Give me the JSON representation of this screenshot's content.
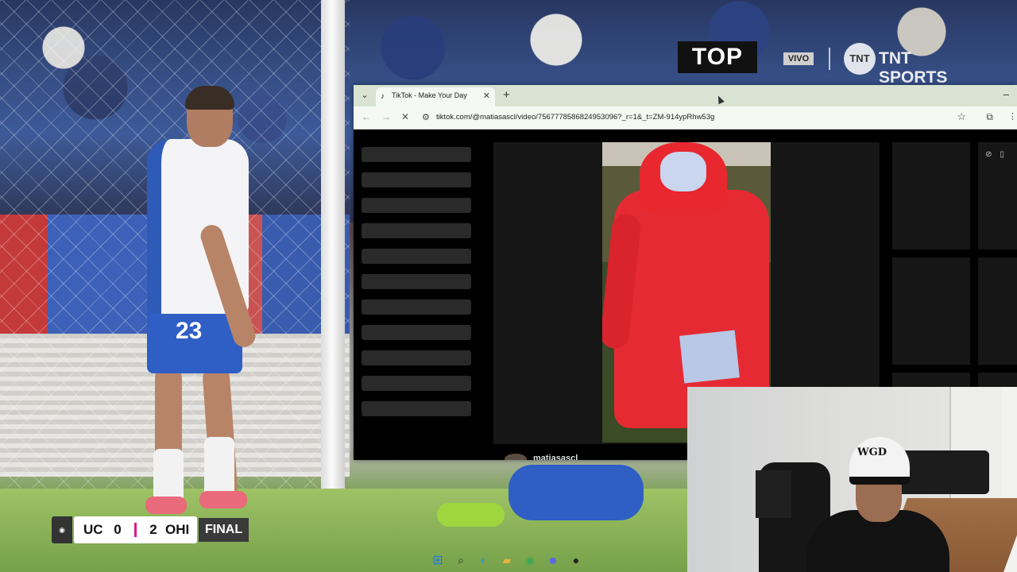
{
  "broadcast": {
    "top_logo": "TOP",
    "live_label": "VIVO",
    "network": "TNT SPORTS",
    "network_mark": "TNT",
    "player_number": "23",
    "scoreboard": {
      "home_team": "UC",
      "home_score": "0",
      "away_score": "2",
      "away_team": "OHI",
      "status": "FINAL"
    }
  },
  "browser": {
    "tab_title": "TikTok - Make Your Day",
    "url": "tiktok.com/@matiasascl/video/7567778586824953096?_r=1&_t=ZM-914ypRhw53g",
    "video_username": "matiasascl"
  },
  "webcam": {
    "cap_text": "WGD"
  },
  "icons": [
    "start-icon",
    "search-icon",
    "edge-icon",
    "file-explorer-icon",
    "chrome-icon",
    "discord-icon",
    "obs-icon"
  ]
}
